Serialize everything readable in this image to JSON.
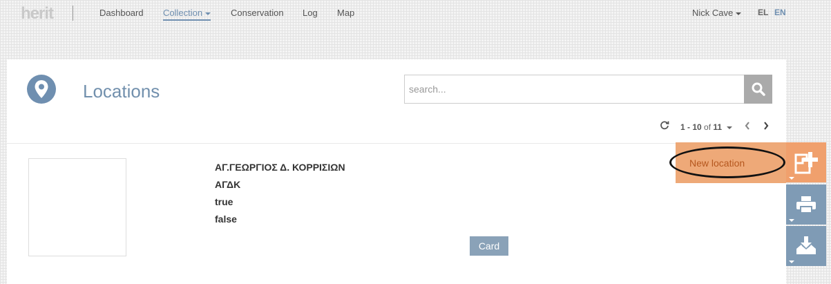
{
  "app": {
    "logo": "herit"
  },
  "nav": {
    "items": [
      {
        "label": "Dashboard"
      },
      {
        "label": "Collection"
      },
      {
        "label": "Conservation"
      },
      {
        "label": "Log"
      },
      {
        "label": "Map"
      }
    ],
    "user": "Nick Cave",
    "languages": [
      "EL",
      "EN"
    ]
  },
  "page": {
    "title": "Locations",
    "icon": "map-pin-icon"
  },
  "search": {
    "placeholder": "search..."
  },
  "pagination": {
    "range": "1 - 10",
    "of": "of",
    "total": "11"
  },
  "record": {
    "name": "ΑΓ.ΓΕΩΡΓΙΟΣ Δ. ΚΟΡΡΙΣΙΩΝ",
    "code": "ΑΓΔΚ",
    "flag1": "true",
    "flag2": "false",
    "card_label": "Card"
  },
  "actions": {
    "new_location": "New location"
  },
  "colors": {
    "accent": "#6f8fb0",
    "orange": "#eea978",
    "orange_dark": "#f0a06d",
    "action_blue": "#7f9bb5"
  }
}
